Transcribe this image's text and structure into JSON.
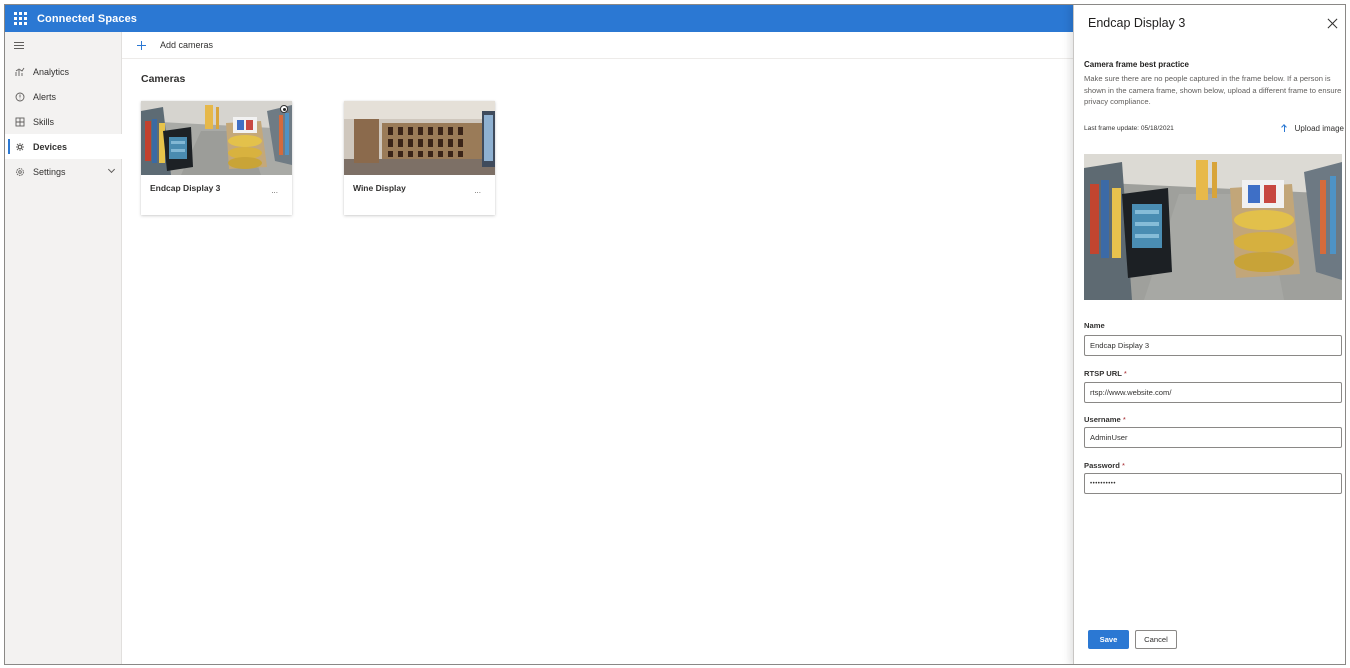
{
  "app": {
    "title": "Connected Spaces"
  },
  "sidebar": {
    "items": [
      {
        "label": "Analytics",
        "icon": "analytics-icon"
      },
      {
        "label": "Alerts",
        "icon": "alert-icon"
      },
      {
        "label": "Skills",
        "icon": "skills-icon"
      },
      {
        "label": "Devices",
        "icon": "devices-icon",
        "active": true
      },
      {
        "label": "Settings",
        "icon": "settings-icon",
        "expandable": true
      }
    ]
  },
  "commandbar": {
    "add_label": "Add cameras"
  },
  "main": {
    "section_title": "Cameras",
    "cards": [
      {
        "name": "Endcap Display 3",
        "more": "...",
        "status_icon": "status-indicator-icon"
      },
      {
        "name": "Wine Display",
        "more": "..."
      }
    ]
  },
  "panel": {
    "title": "Endcap Display 3",
    "best_practice_title": "Camera frame best practice",
    "best_practice_text": "Make sure there are no people captured in the frame below. If a person is shown in the camera frame, shown below, upload a different frame to ensure privacy compliance.",
    "last_frame": "Last frame update: 05/18/2021",
    "upload_label": "Upload image",
    "fields": {
      "name": {
        "label": "Name",
        "value": "Endcap Display 3",
        "required": false
      },
      "rtsp": {
        "label": "RTSP URL",
        "value": "rtsp://www.website.com/",
        "required": true
      },
      "username": {
        "label": "Username",
        "value": "AdminUser",
        "required": true
      },
      "password": {
        "label": "Password",
        "value": "••••••••••",
        "required": true
      }
    },
    "required_marker": "*",
    "save_label": "Save",
    "cancel_label": "Cancel"
  },
  "colors": {
    "accent": "#2b78d3",
    "required": "#a4262c"
  }
}
